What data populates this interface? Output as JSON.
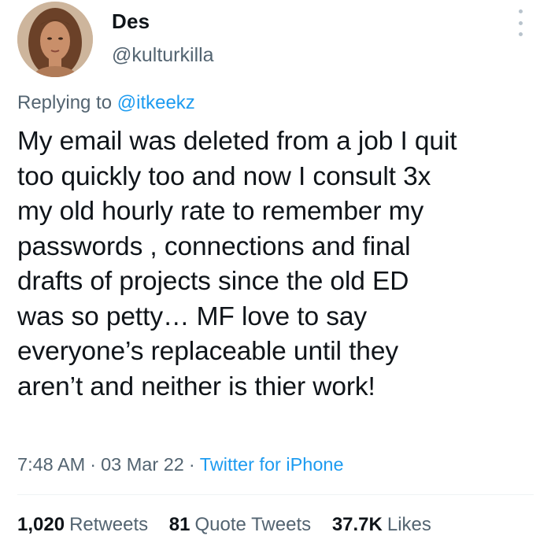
{
  "author": {
    "display_name": "Des",
    "handle": "@kulturkilla"
  },
  "reply": {
    "prefix": "Replying to",
    "to_handle": "@itkeekz"
  },
  "tweet": {
    "text": "My email was deleted from a job I quit\ntoo quickly too and now I consult 3x\nmy old hourly rate to remember my\npasswords , connections and final\ndrafts of projects since the old ED\nwas so petty… MF love to say\neveryone’s replaceable until they\naren’t and neither is thier work!",
    "time": "7:48 AM",
    "date": "03 Mar 22",
    "separator": "·",
    "source": "Twitter for iPhone"
  },
  "stats": {
    "retweets_count": "1,020",
    "retweets_label": "Retweets",
    "quotes_count": "81",
    "quotes_label": "Quote Tweets",
    "likes_count": "37.7K",
    "likes_label": "Likes"
  },
  "icons": {
    "more": "more-vertical-icon"
  },
  "colors": {
    "link": "#1d9bf0",
    "secondary_text": "#536471",
    "primary_text": "#0f1419"
  }
}
